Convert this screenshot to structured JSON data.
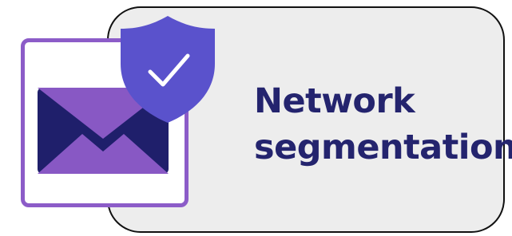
{
  "card": {
    "title_line1": "Network",
    "title_line2": "segmentation"
  },
  "icons": {
    "mail": "envelope-icon",
    "security": "shield-check-icon"
  },
  "colors": {
    "card_background": "#ededed",
    "card_border": "#111111",
    "title_text": "#24246e",
    "tile_border": "#8c5cc8",
    "envelope_dark": "#1f1f6b",
    "envelope_light": "#8858c4",
    "shield": "#5a52cc",
    "check": "#ffffff"
  }
}
